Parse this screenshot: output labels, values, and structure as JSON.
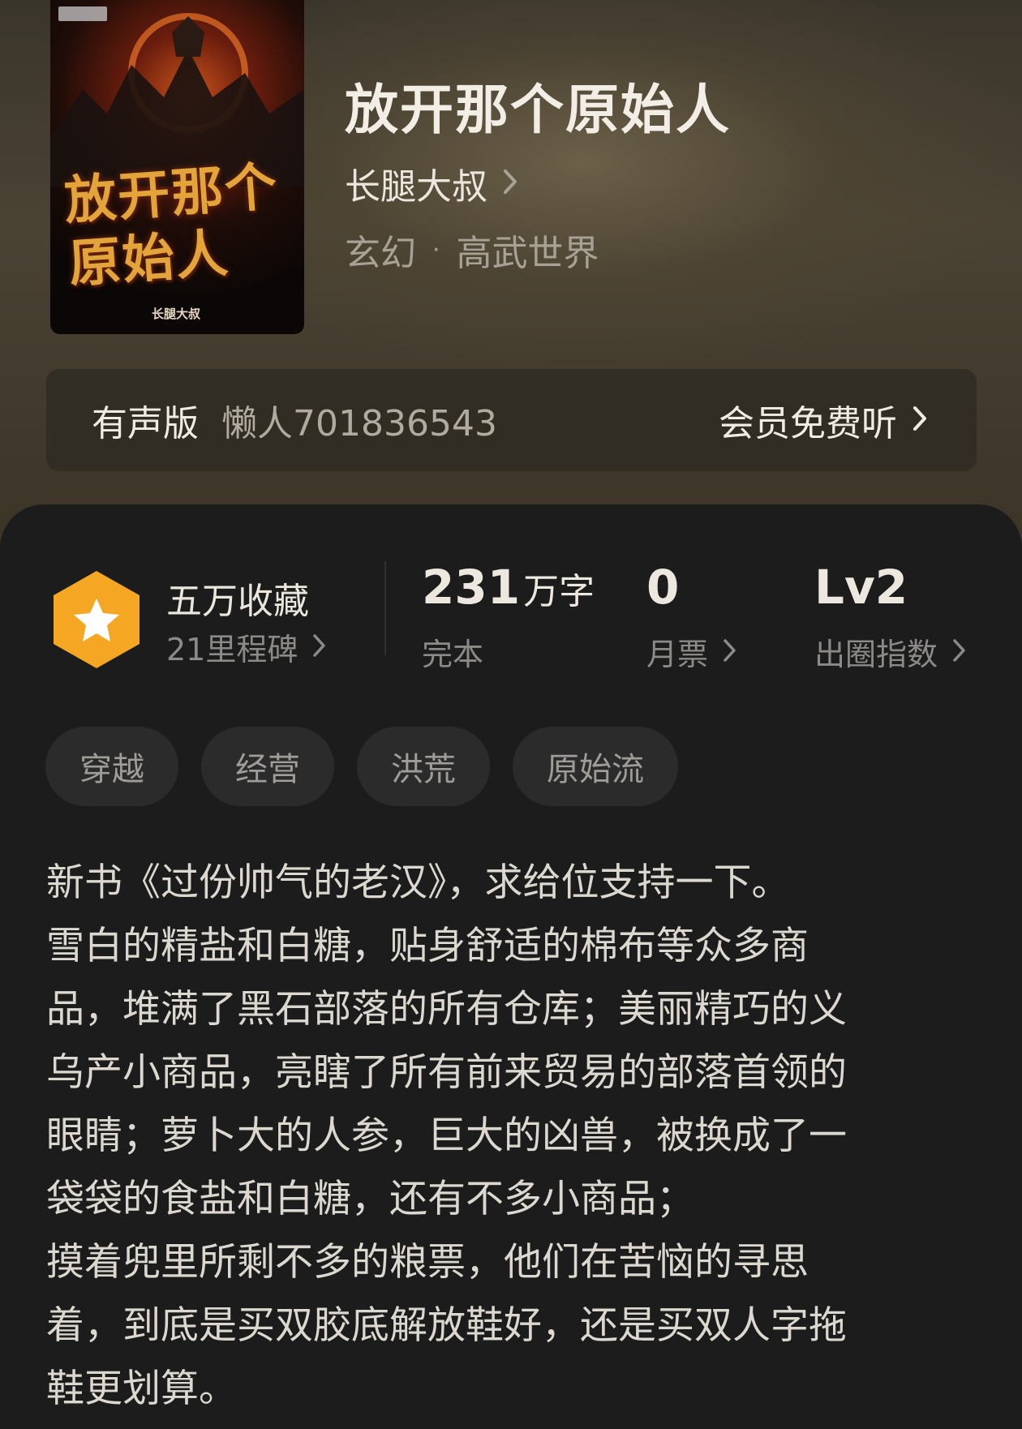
{
  "book": {
    "title": "放开那个原始人",
    "author": "长腿大叔",
    "genre_primary": "玄幻",
    "genre_separator": "·",
    "genre_secondary": "高武世界",
    "cover": {
      "title_line1": "放开那个",
      "title_line2": "原始人",
      "author_mark": "长腿大叔"
    }
  },
  "audio": {
    "label": "有声版",
    "narrator": "懒人701836543",
    "cta": "会员免费听"
  },
  "stats": {
    "favorites_title": "五万收藏",
    "favorites_sub": "21里程碑",
    "words_number": "231",
    "words_unit": "万字",
    "words_status": "完本",
    "monthly_ticket_value": "0",
    "monthly_ticket_label": "月票",
    "level_value": "Lv2",
    "level_label": "出圈指数"
  },
  "tags": [
    "穿越",
    "经营",
    "洪荒",
    "原始流"
  ],
  "synopsis": "新书《过份帅气的老汉》，求给位支持一下。\n雪白的精盐和白糖，贴身舒适的棉布等众多商\n品，堆满了黑石部落的所有仓库；美丽精巧的义\n乌产小商品，亮瞎了所有前来贸易的部落首领的\n眼睛；萝卜大的人参，巨大的凶兽，被换成了一\n袋袋的食盐和白糖，还有不多小商品；\n摸着兜里所剩不多的粮票，他们在苦恼的寻思\n着，到底是买双胶底解放鞋好，还是买双人字拖\n鞋更划算。",
  "colors": {
    "badge_orange": "#f5a623",
    "panel_bg": "#1c1c1c",
    "tag_bg": "#2b2b2b"
  }
}
